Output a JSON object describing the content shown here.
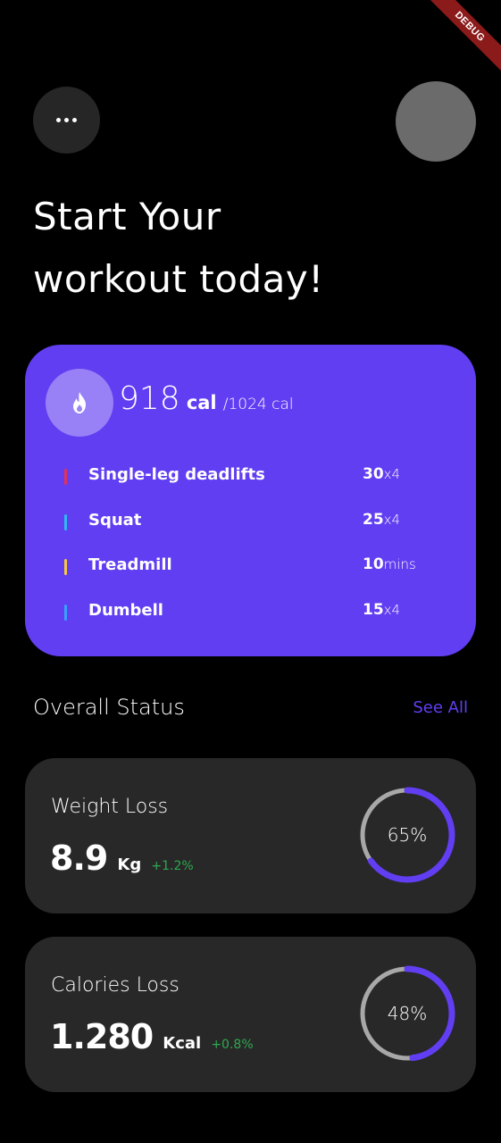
{
  "debug_banner": "DEBUG",
  "header": {
    "headline_line1": "Start Your",
    "headline_line2": "workout today!",
    "menu_icon": "more-horizontal-icon"
  },
  "workout": {
    "icon": "flame-icon",
    "calories": "918",
    "calories_unit": "cal",
    "calories_goal": "/1024 cal",
    "accent_color": "#613ef2",
    "exercises": [
      {
        "name": "Single-leg deadlifts",
        "amount": "30",
        "unit": "x4",
        "color": "#e0315a"
      },
      {
        "name": "Squat",
        "amount": "25",
        "unit": "x4",
        "color": "#2fb8f0"
      },
      {
        "name": "Treadmill",
        "amount": "10",
        "unit": "mins",
        "color": "#f5c842"
      },
      {
        "name": "Dumbell",
        "amount": "15",
        "unit": "x4",
        "color": "#3aa0ff"
      }
    ]
  },
  "overall": {
    "title": "Overall Status",
    "see_all": "See All"
  },
  "stats": [
    {
      "title": "Weight Loss",
      "value": "8.9",
      "unit": "Kg",
      "delta": "+1.2%",
      "percent_label": "65%",
      "progress": 0.65
    },
    {
      "title": "Calories Loss",
      "value": "1.280",
      "unit": "Kcal",
      "delta": "+0.8%",
      "percent_label": "48%",
      "progress": 0.48
    }
  ]
}
